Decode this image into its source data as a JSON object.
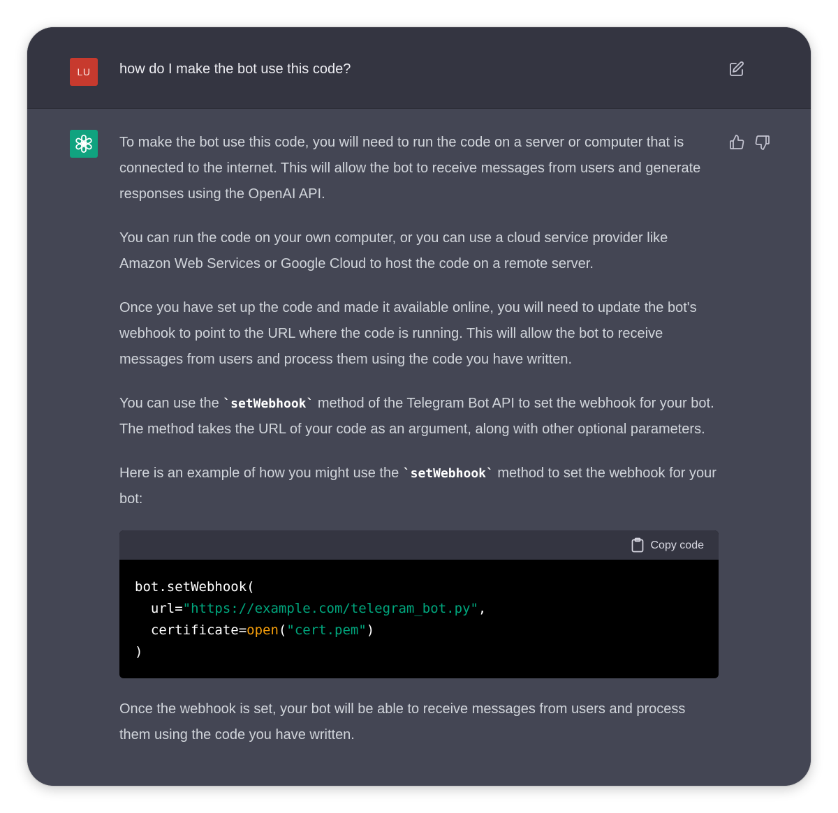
{
  "user_message": {
    "avatar_initials": "LU",
    "text": "how do I make the bot use this code?",
    "edit_icon": "edit-icon"
  },
  "assistant_message": {
    "avatar_icon": "openai-logo-icon",
    "feedback": {
      "thumbs_up_icon": "thumbs-up-icon",
      "thumbs_down_icon": "thumbs-down-icon"
    },
    "paragraphs": {
      "p1": "To make the bot use this code, you will need to run the code on a server or computer that is connected to the internet. This will allow the bot to receive messages from users and generate responses using the OpenAI API.",
      "p2": "You can run the code on your own computer, or you can use a cloud service provider like Amazon Web Services or Google Cloud to host the code on a remote server.",
      "p3": "Once you have set up the code and made it available online, you will need to update the bot's webhook to point to the URL where the code is running. This will allow the bot to receive messages from users and process them using the code you have written.",
      "p4_before": "You can use the ",
      "p4_code": "`setWebhook`",
      "p4_after": " method of the Telegram Bot API to set the webhook for your bot. The method takes the URL of your code as an argument, along with other optional parameters.",
      "p5_before": "Here is an example of how you might use the ",
      "p5_code": "`setWebhook`",
      "p5_after": " method to set the webhook for your bot:",
      "p6": "Once the webhook is set, your bot will be able to receive messages from users and process them using the code you have written."
    },
    "code_block": {
      "copy_label": "Copy code",
      "copy_icon": "clipboard-icon",
      "line1": "bot.setWebhook(",
      "line2_key": "  url=",
      "line2_str": "\"https://example.com/telegram_bot.py\"",
      "line2_end": ",",
      "line3_key": "  certificate=",
      "line3_fn": "open",
      "line3_open": "(",
      "line3_str": "\"cert.pem\"",
      "line3_close": ")",
      "line4": ")"
    }
  },
  "colors": {
    "user_bg": "#343541",
    "assistant_bg": "#444654",
    "user_avatar": "#c73a2e",
    "bot_avatar": "#10a37f",
    "code_string": "#00a67d",
    "code_function": "#f59e0b"
  }
}
